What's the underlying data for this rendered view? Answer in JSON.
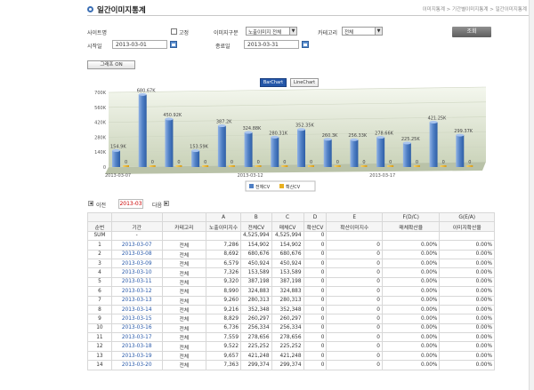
{
  "page": {
    "title": "일간이미지통계",
    "breadcrumb": "이미지통계 > 기간별이미지통계 > 일간이미지통계"
  },
  "filters": {
    "site_label": "사이트명",
    "fixed_label": "고정",
    "image_type_label": "이미지구분",
    "image_type_value": "노출이미지 전체",
    "category_label": "카테고리",
    "category_value": "전체",
    "start_label": "시작일",
    "start_value": "2013-03-01",
    "end_label": "종료일",
    "end_value": "2013-03-31",
    "search_button": "조회",
    "graph_button": "그래프 ON"
  },
  "chart_tabs": {
    "bar": "BarChart",
    "line": "LineChart"
  },
  "chart_data": {
    "type": "bar",
    "ylim": [
      0,
      700000
    ],
    "yticks": [
      "0",
      "140K",
      "280K",
      "420K",
      "560K",
      "700K"
    ],
    "x_tick_labels": [
      "2013-03-07",
      "2013-03-12",
      "2013-03-17"
    ],
    "series": [
      {
        "name": "전체CV",
        "color": "#4f7fc4",
        "values": [
          154900,
          680670,
          450920,
          153590,
          387200,
          324880,
          280310,
          352350,
          260300,
          256330,
          278660,
          225250,
          421250,
          299370
        ],
        "labels": [
          "154.9K",
          "680.67K",
          "450.92K",
          "153.59K",
          "387.2K",
          "324.88K",
          "280.31K",
          "352.35K",
          "260.3K",
          "256.33K",
          "278.66K",
          "225.25K",
          "421.25K",
          "299.37K"
        ]
      },
      {
        "name": "확산CV",
        "color": "#e8b020",
        "values": [
          0,
          0,
          0,
          0,
          0,
          0,
          0,
          0,
          0,
          0,
          0,
          0,
          0,
          0
        ],
        "labels": [
          "0",
          "0",
          "0",
          "0",
          "0",
          "0",
          "0",
          "0",
          "0",
          "0",
          "0",
          "0",
          "0",
          "0"
        ]
      }
    ]
  },
  "pager": {
    "prev": "이전",
    "current": "2013-03",
    "next": "다음"
  },
  "table": {
    "letters": [
      "A",
      "B",
      "C",
      "D",
      "E",
      "F(D/C)",
      "G(E/A)"
    ],
    "headers": [
      "순번",
      "기간",
      "카테고리",
      "노출이미지수",
      "전체CV",
      "매체CV",
      "확산CV",
      "확산이미지수",
      "매체확산율",
      "이미지확산율"
    ],
    "sum_row": [
      "SUM",
      "-",
      "",
      "",
      "4,525,994",
      "4,525,994",
      "0",
      "",
      "",
      ""
    ],
    "rows": [
      [
        "1",
        "2013-03-07",
        "전체",
        "7,286",
        "154,902",
        "154,902",
        "0",
        "0",
        "0.00%",
        "0.00%"
      ],
      [
        "2",
        "2013-03-08",
        "전체",
        "8,692",
        "680,676",
        "680,676",
        "0",
        "0",
        "0.00%",
        "0.00%"
      ],
      [
        "3",
        "2013-03-09",
        "전체",
        "6,579",
        "450,924",
        "450,924",
        "0",
        "0",
        "0.00%",
        "0.00%"
      ],
      [
        "4",
        "2013-03-10",
        "전체",
        "7,326",
        "153,589",
        "153,589",
        "0",
        "0",
        "0.00%",
        "0.00%"
      ],
      [
        "5",
        "2013-03-11",
        "전체",
        "9,320",
        "387,198",
        "387,198",
        "0",
        "0",
        "0.00%",
        "0.00%"
      ],
      [
        "6",
        "2013-03-12",
        "전체",
        "8,990",
        "324,883",
        "324,883",
        "0",
        "0",
        "0.00%",
        "0.00%"
      ],
      [
        "7",
        "2013-03-13",
        "전체",
        "9,260",
        "280,313",
        "280,313",
        "0",
        "0",
        "0.00%",
        "0.00%"
      ],
      [
        "8",
        "2013-03-14",
        "전체",
        "9,216",
        "352,348",
        "352,348",
        "0",
        "0",
        "0.00%",
        "0.00%"
      ],
      [
        "9",
        "2013-03-15",
        "전체",
        "8,829",
        "260,297",
        "260,297",
        "0",
        "0",
        "0.00%",
        "0.00%"
      ],
      [
        "10",
        "2013-03-16",
        "전체",
        "6,736",
        "256,334",
        "256,334",
        "0",
        "0",
        "0.00%",
        "0.00%"
      ],
      [
        "11",
        "2013-03-17",
        "전체",
        "7,559",
        "278,656",
        "278,656",
        "0",
        "0",
        "0.00%",
        "0.00%"
      ],
      [
        "12",
        "2013-03-18",
        "전체",
        "9,522",
        "225,252",
        "225,252",
        "0",
        "0",
        "0.00%",
        "0.00%"
      ],
      [
        "13",
        "2013-03-19",
        "전체",
        "9,657",
        "421,248",
        "421,248",
        "0",
        "0",
        "0.00%",
        "0.00%"
      ],
      [
        "14",
        "2013-03-20",
        "전체",
        "7,363",
        "299,374",
        "299,374",
        "0",
        "0",
        "0.00%",
        "0.00%"
      ]
    ]
  }
}
